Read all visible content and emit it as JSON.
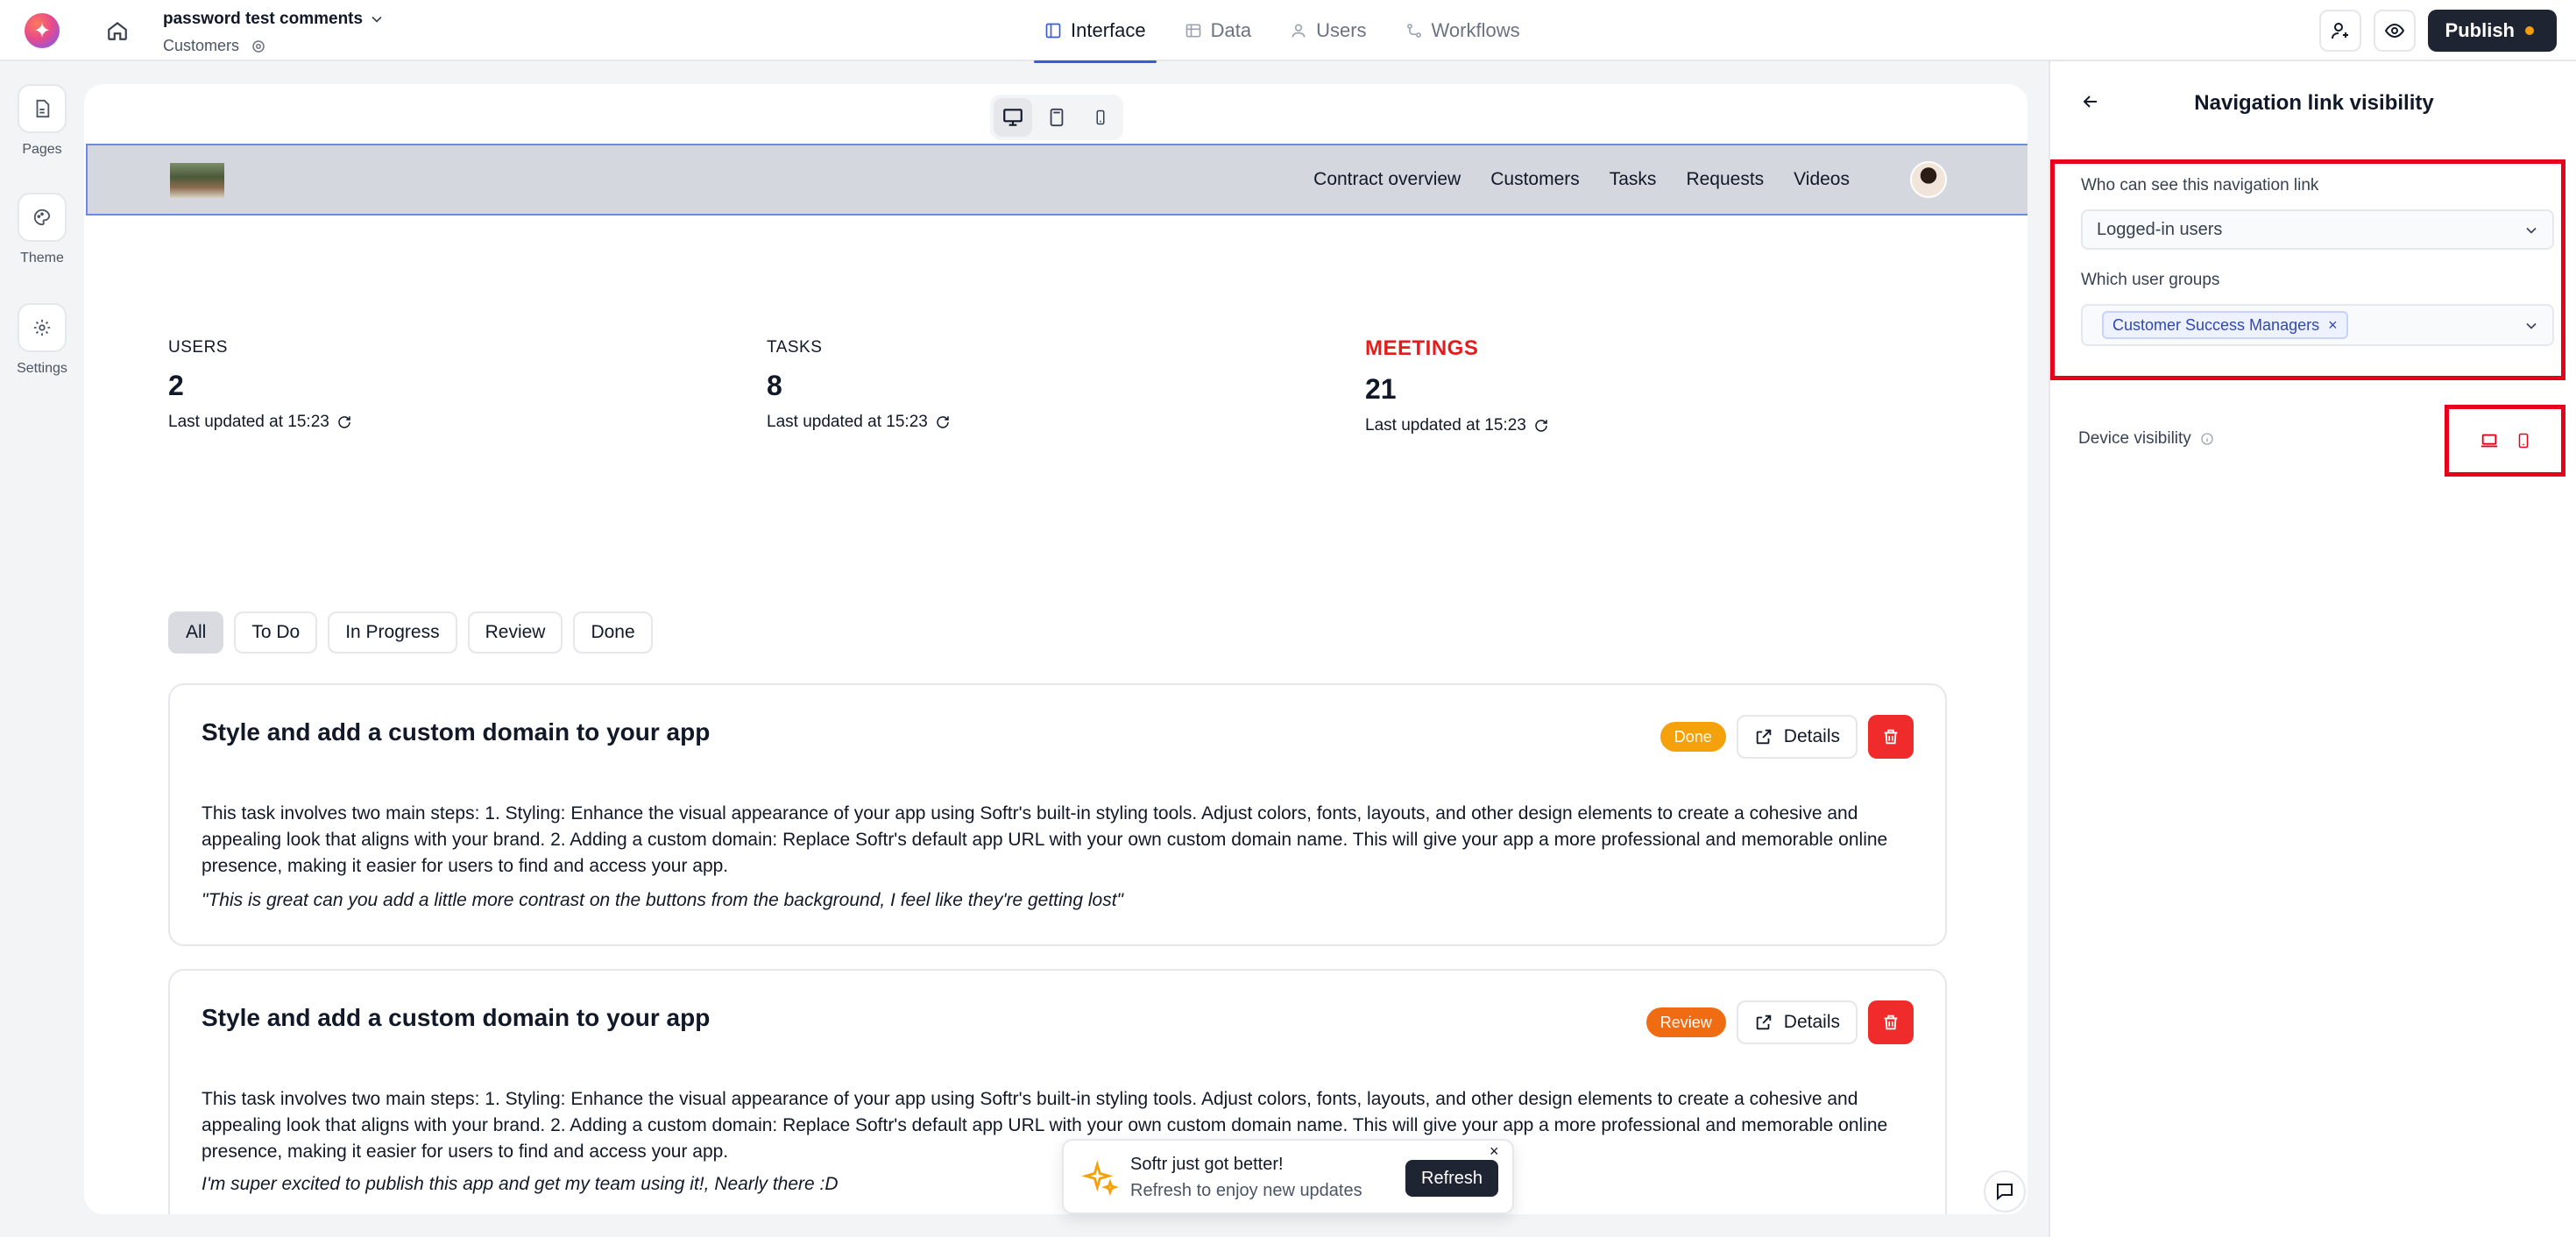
{
  "app": {
    "title": "password test comments",
    "subtitle": "Customers"
  },
  "topnav": {
    "items": [
      {
        "label": "Interface",
        "icon": "layout-icon",
        "active": true
      },
      {
        "label": "Data",
        "icon": "table-icon",
        "active": false
      },
      {
        "label": "Users",
        "icon": "user-icon",
        "active": false
      },
      {
        "label": "Workflows",
        "icon": "workflow-icon",
        "active": false
      }
    ],
    "publish_label": "Publish"
  },
  "leftrail": {
    "items": [
      {
        "label": "Pages",
        "icon": "page-icon"
      },
      {
        "label": "Theme",
        "icon": "palette-icon"
      },
      {
        "label": "Settings",
        "icon": "gear-icon"
      }
    ]
  },
  "site": {
    "nav": [
      "Contract overview",
      "Customers",
      "Tasks",
      "Requests",
      "Videos"
    ]
  },
  "stats": [
    {
      "label": "USERS",
      "value": "2",
      "updated": "Last updated at 15:23",
      "highlight": false
    },
    {
      "label": "TASKS",
      "value": "8",
      "updated": "Last updated at 15:23",
      "highlight": false
    },
    {
      "label": "MEETINGS",
      "value": "21",
      "updated": "Last updated at 15:23",
      "highlight": true
    }
  ],
  "filters": [
    "All",
    "To Do",
    "In Progress",
    "Review",
    "Done"
  ],
  "tasks": [
    {
      "title": "Style and add a custom domain to your app",
      "status": "Done",
      "status_color": "#f5a10b",
      "details_label": "Details",
      "description": "This task involves two main steps: 1. Styling: Enhance the visual appearance of your app using Softr's built-in styling tools. Adjust colors, fonts, layouts, and other design elements to create a cohesive and appealing look that aligns with your brand. 2. Adding a custom domain: Replace Softr's default app URL with your own custom domain name. This will give your app a more professional and memorable online presence, making it easier for users to find and access your app.",
      "comment": "\"This is great can you add a little more contrast on the buttons from the background, I feel like they're getting lost\""
    },
    {
      "title": "Style and add a custom domain to your app",
      "status": "Review",
      "status_color": "#ef6c12",
      "details_label": "Details",
      "description": "This task involves two main steps: 1. Styling: Enhance the visual appearance of your app using Softr's built-in styling tools. Adjust colors, fonts, layouts, and other design elements to create a cohesive and appealing look that aligns with your brand. 2. Adding a custom domain: Replace Softr's default app URL with your own custom domain name. This will give your app a more professional and memorable online presence, making it easier for users to find and access your app.",
      "comment": "I'm super excited to publish this app and get my team using it!, Nearly there :D"
    }
  ],
  "toast": {
    "title": "Softr just got better!",
    "subtitle": "Refresh to enjoy new updates",
    "button": "Refresh"
  },
  "panel": {
    "title": "Navigation link visibility",
    "who_label": "Who can see this navigation link",
    "who_value": "Logged-in users",
    "groups_label": "Which user groups",
    "groups_tag": "Customer Success Managers",
    "device_label": "Device visibility"
  },
  "colors": {
    "accent": "#3b5bdb",
    "highlight_box": "#e8001a",
    "delete": "#ef2b2b",
    "publish_bg": "#1f2433"
  }
}
